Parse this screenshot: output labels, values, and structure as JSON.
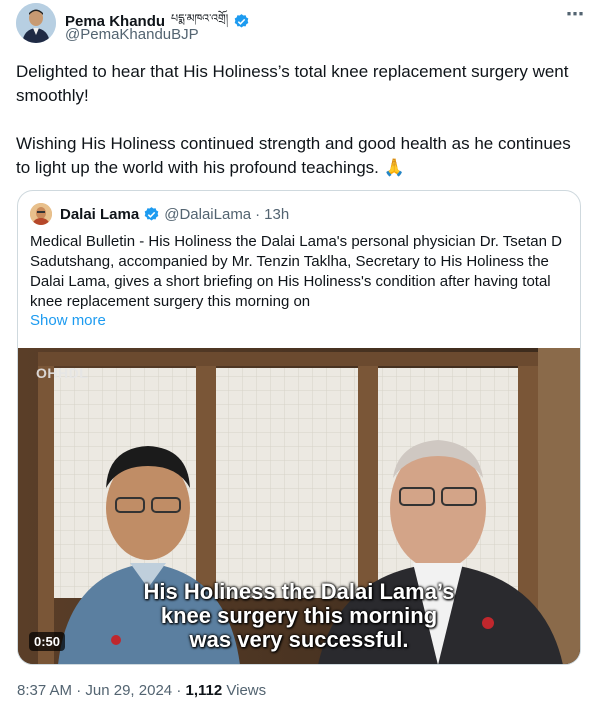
{
  "author": {
    "name": "Pema Khandu",
    "name_script": "པདྨ་མཁའ་འགྲོ།",
    "handle": "@PemaKhanduBJP"
  },
  "more_icon": "⋯",
  "tweet": {
    "paragraph1": "Delighted to hear that His Holiness’s total knee replacement surgery went smoothly!",
    "paragraph2": "Wishing His Holiness continued strength and good health as he continues to light up the world with his profound teachings. 🙏"
  },
  "quoted": {
    "name": "Dalai Lama",
    "handle": "@DalaiLama",
    "separator": "·",
    "time": "13h",
    "text": "Medical Bulletin - His Holiness the Dalai Lama's personal physician Dr. Tsetan D Sadutshang, accompanied by Mr. Tenzin Taklha, Secretary to His Holiness the Dalai Lama, gives a short briefing on His Holiness's condition after having total knee replacement surgery this morning on",
    "show_more": "Show more",
    "video": {
      "watermark": "OHHDL",
      "caption_line1": "His Holiness the Dalai Lama’s",
      "caption_line2": "knee surgery this morning",
      "caption_line3": "was very successful.",
      "duration": "0:50"
    }
  },
  "meta": {
    "time": "8:37 AM",
    "separator1": "·",
    "date": "Jun 29, 2024",
    "separator2": "·",
    "views_count": "1,112",
    "views_label": "Views"
  },
  "colors": {
    "verified_blue": "#1d9bf0",
    "link_blue": "#1d9bf0",
    "secondary_text": "#536471"
  },
  "icons": [
    "verified-badge-icon",
    "more-options-icon",
    "play-video"
  ]
}
